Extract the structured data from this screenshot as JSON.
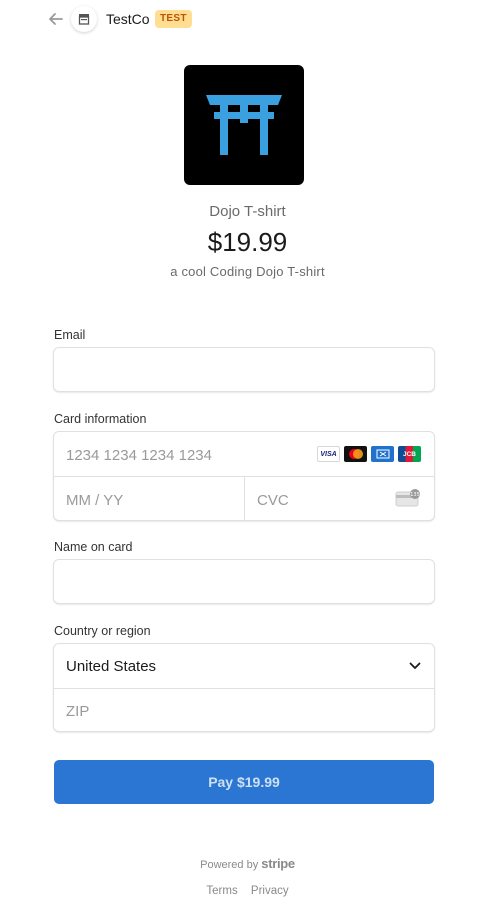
{
  "header": {
    "merchant_name": "TestCo",
    "test_badge": "TEST"
  },
  "product": {
    "name": "Dojo T-shirt",
    "price": "$19.99",
    "description": "a cool Coding Dojo T-shirt"
  },
  "form": {
    "email_label": "Email",
    "email_value": "",
    "card_label": "Card information",
    "card_number_placeholder": "1234 1234 1234 1234",
    "expiry_placeholder": "MM / YY",
    "cvc_placeholder": "CVC",
    "card_brands": [
      "VISA",
      "mastercard",
      "AMEX",
      "JCB"
    ],
    "cvc_hint": "135",
    "name_label": "Name on card",
    "name_value": "",
    "country_label": "Country or region",
    "country_value": "United States",
    "zip_placeholder": "ZIP"
  },
  "pay_button": {
    "label": "Pay $19.99"
  },
  "footer": {
    "powered_by": "Powered by",
    "brand": "stripe",
    "links": [
      "Terms",
      "Privacy"
    ]
  },
  "colors": {
    "accent": "#2a76d2",
    "badge_bg": "#ffde92",
    "badge_text": "#bb5504",
    "logo_icon": "#3aa0e0"
  },
  "icons": {
    "back": "arrow-left-icon",
    "merchant": "storefront-icon",
    "select": "chevron-down-icon",
    "cvc": "card-back-icon"
  }
}
